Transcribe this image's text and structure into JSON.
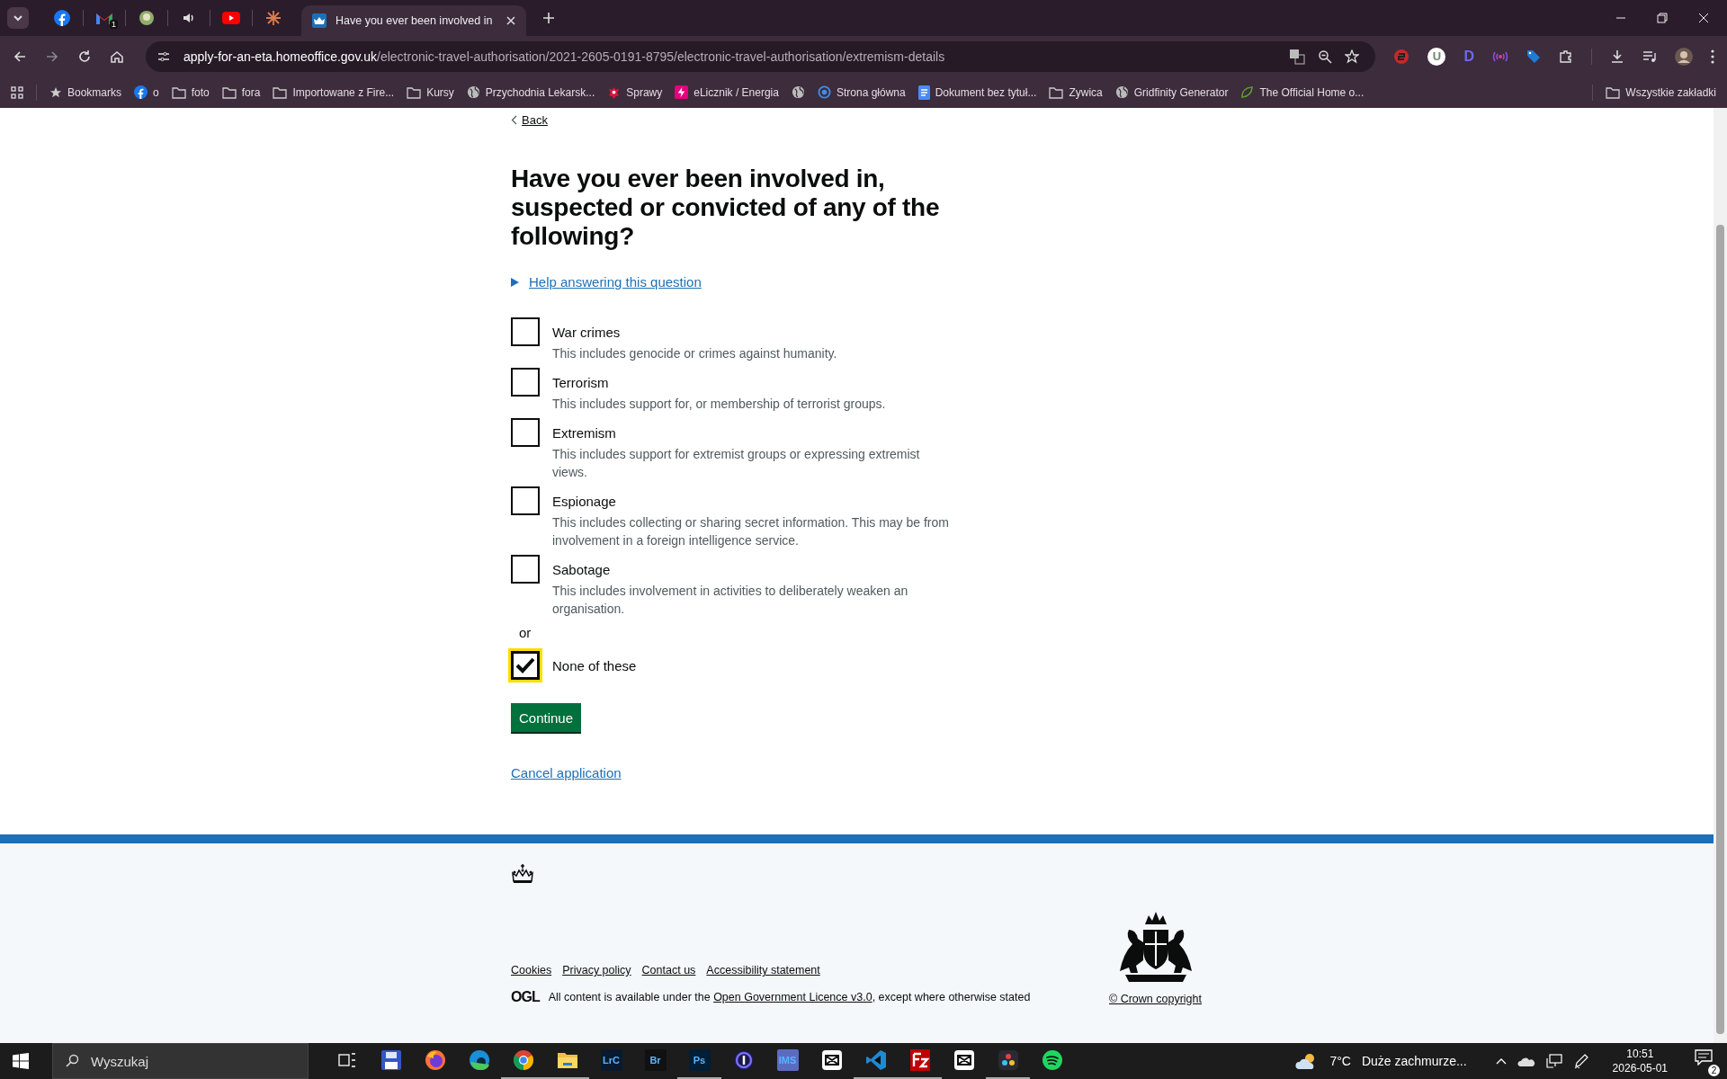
{
  "browser": {
    "tabs": [
      {
        "kind": "facebook",
        "selected": false
      },
      {
        "kind": "gmail",
        "badge": "1",
        "selected": false
      },
      {
        "kind": "app",
        "selected": false
      },
      {
        "kind": "audio",
        "selected": false
      },
      {
        "kind": "youtube",
        "selected": false
      },
      {
        "kind": "sunburst",
        "selected": false
      },
      {
        "kind": "page",
        "title": "Have you ever been involved in",
        "selected": true
      }
    ],
    "url_host": "apply-for-an-eta.homeoffice.gov.uk",
    "url_path": "/electronic-travel-authorisation/2021-2605-0191-8795/electronic-travel-authorisation/extremism-details",
    "extensions": [
      {
        "kind": "seo"
      },
      {
        "kind": "letter",
        "label": "U"
      },
      {
        "kind": "dlogo",
        "label": "D"
      },
      {
        "kind": "wave"
      },
      {
        "kind": "tag"
      }
    ],
    "bookmarks": [
      {
        "kind": "star",
        "label": "Bookmarks"
      },
      {
        "kind": "facebook",
        "label": "o"
      },
      {
        "kind": "folder",
        "label": "foto"
      },
      {
        "kind": "folder",
        "label": "fora"
      },
      {
        "kind": "folder",
        "label": "Importowane z Fire..."
      },
      {
        "kind": "folder",
        "label": "Kursy"
      },
      {
        "kind": "globe",
        "label": "Przychodnia Lekarsk..."
      },
      {
        "kind": "eagle",
        "label": "Sprawy"
      },
      {
        "kind": "pink",
        "label": "eLicznik / Energia"
      },
      {
        "kind": "globe"
      },
      {
        "kind": "circle",
        "label": "Strona główna"
      },
      {
        "kind": "doc",
        "label": "Dokument bez tytuł..."
      },
      {
        "kind": "folder",
        "label": "Zywica"
      },
      {
        "kind": "globe",
        "label": "Gridfinity Generator"
      },
      {
        "kind": "leaf",
        "label": "The Official Home o..."
      }
    ],
    "all_bookmarks": "Wszystkie zakładki"
  },
  "page": {
    "back": "Back",
    "heading": "Have you ever been involved in, suspected or convicted of any of the following?",
    "help": "Help answering this question",
    "options": [
      {
        "label": "War crimes",
        "hint": "This includes genocide or crimes against humanity.",
        "checked": false
      },
      {
        "label": "Terrorism",
        "hint": "This includes support for, or membership of terrorist groups.",
        "checked": false
      },
      {
        "label": "Extremism",
        "hint": "This includes support for extremist groups or expressing extremist views.",
        "checked": false
      },
      {
        "label": "Espionage",
        "hint": "This includes collecting or sharing secret information. This may be from involvement in a foreign intelligence service.",
        "checked": false
      },
      {
        "label": "Sabotage",
        "hint": "This includes involvement in activities to deliberately weaken an organisation.",
        "checked": false
      }
    ],
    "or": "or",
    "none": {
      "label": "None of these",
      "checked": true,
      "focused": true
    },
    "continue": "Continue",
    "cancel": "Cancel application"
  },
  "footer": {
    "links": [
      "Cookies",
      "Privacy policy",
      "Contact us",
      "Accessibility statement"
    ],
    "ogl": "OGL",
    "licence_before": "All content is available under the ",
    "licence_link": "Open Government Licence v3.0",
    "licence_after": ", except where otherwise stated",
    "copyright": "© Crown copyright"
  },
  "taskbar": {
    "search": {
      "placeholder": "Wyszukaj"
    },
    "apps": [
      {
        "kind": "taskview",
        "running": false
      },
      {
        "kind": "floppy",
        "running": false
      },
      {
        "kind": "firefox",
        "running": false
      },
      {
        "kind": "edge",
        "running": false
      },
      {
        "kind": "chrome",
        "running": true
      },
      {
        "kind": "explorer",
        "running": true
      },
      {
        "kind": "tile",
        "label": "LrC",
        "color": "#0a1a2e",
        "running": false
      },
      {
        "kind": "tile",
        "label": "Br",
        "color": "#111111",
        "running": false
      },
      {
        "kind": "tile",
        "label": "Ps",
        "color": "#001e36",
        "running": true
      },
      {
        "kind": "ring",
        "running": false
      },
      {
        "kind": "tile",
        "label": "IMS",
        "color": "#5b6cc0",
        "running": false
      },
      {
        "kind": "capcut",
        "running": false
      },
      {
        "kind": "vscode",
        "running": true
      },
      {
        "kind": "filezilla",
        "running": true
      },
      {
        "kind": "capcut",
        "running": false
      },
      {
        "kind": "davinci",
        "running": true
      },
      {
        "kind": "spotify",
        "running": false
      }
    ],
    "temperature": "7°C",
    "weather": "Duże zachmurze...",
    "time": "10:51",
    "date": "2026-05-01",
    "notifications": "2"
  }
}
